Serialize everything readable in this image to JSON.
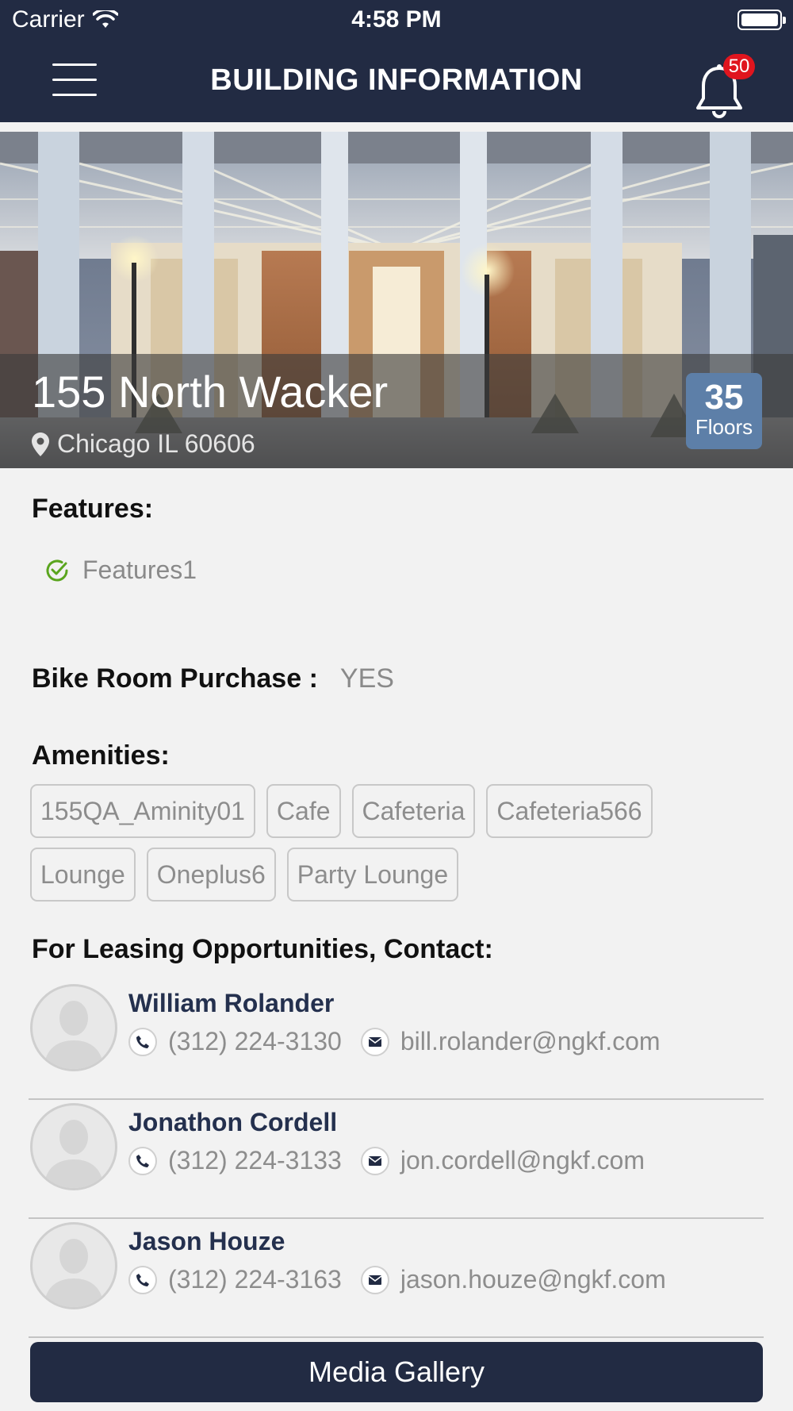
{
  "status_bar": {
    "carrier": "Carrier",
    "time": "4:58 PM"
  },
  "header": {
    "title": "BUILDING INFORMATION",
    "notification_count": "50"
  },
  "building": {
    "name": "155 North Wacker",
    "location": "Chicago IL 60606",
    "floors_count": "35",
    "floors_label": "Floors"
  },
  "features": {
    "title": "Features:",
    "items": [
      "Features1"
    ]
  },
  "bike_room": {
    "label": "Bike Room Purchase :",
    "value": "YES"
  },
  "amenities": {
    "title": "Amenities:",
    "items": [
      "155QA_Aminity01",
      "Cafe",
      "Cafeteria",
      "Cafeteria566",
      "Lounge",
      "Oneplus6",
      "Party Lounge"
    ]
  },
  "contacts": {
    "title": "For Leasing Opportunities, Contact:",
    "items": [
      {
        "name": "William Rolander",
        "phone": "(312) 224-3130",
        "email": "bill.rolander@ngkf.com"
      },
      {
        "name": "Jonathon Cordell",
        "phone": "(312) 224-3133",
        "email": "jon.cordell@ngkf.com"
      },
      {
        "name": "Jason Houze",
        "phone": "(312) 224-3163",
        "email": "jason.houze@ngkf.com"
      }
    ]
  },
  "media_gallery": {
    "label": "Media Gallery"
  },
  "colors": {
    "navy": "#222b43",
    "badge_red": "#e0151e",
    "floors_blue": "#5d7fa8",
    "check_green": "#5aa51e",
    "background": "#f2f2f2"
  }
}
